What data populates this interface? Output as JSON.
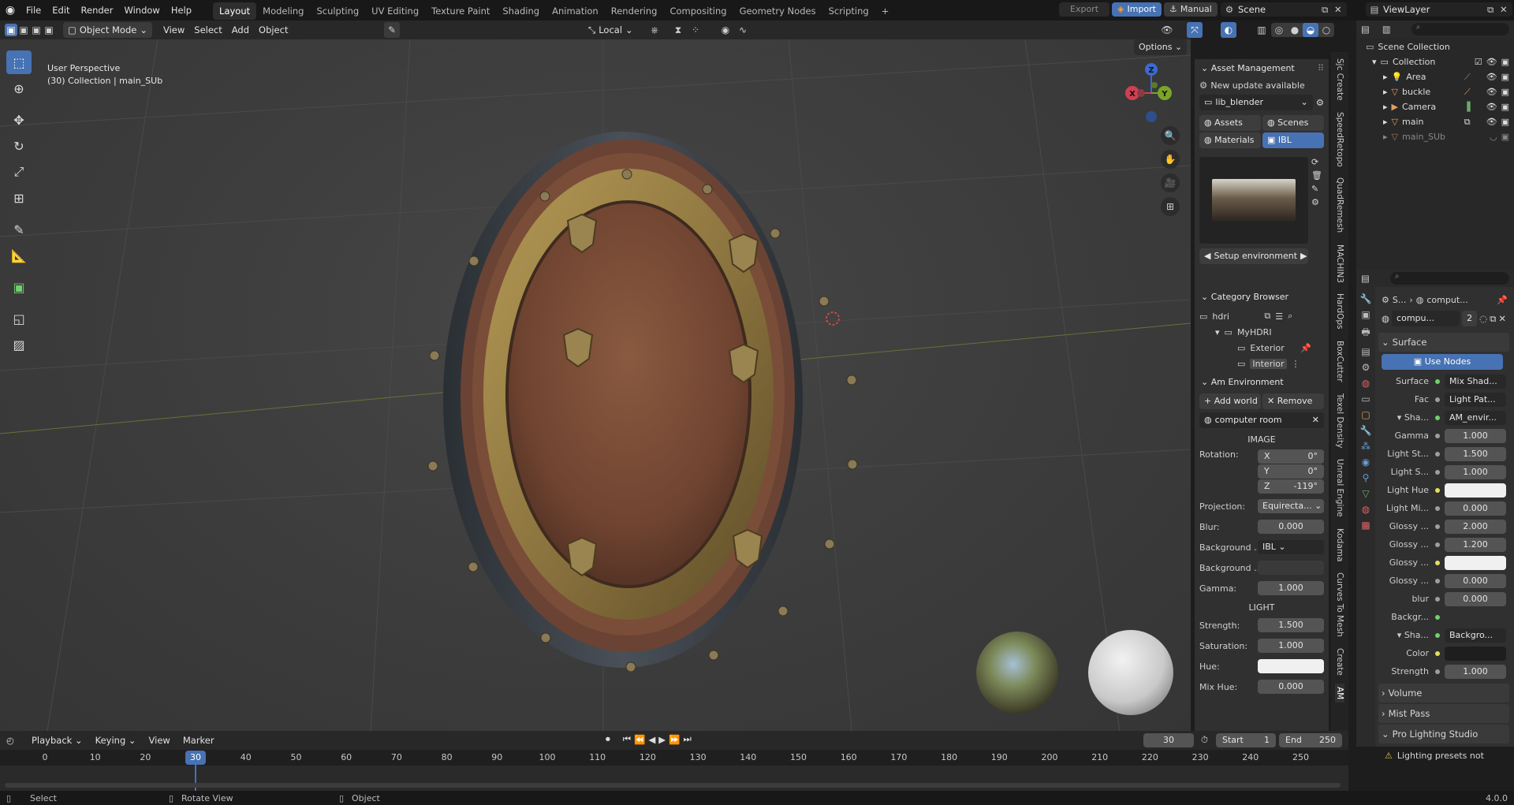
{
  "topbar": {
    "menus": [
      "File",
      "Edit",
      "Render",
      "Window",
      "Help"
    ],
    "workspaces": [
      "Layout",
      "Modeling",
      "Sculpting",
      "UV Editing",
      "Texture Paint",
      "Shading",
      "Animation",
      "Rendering",
      "Compositing",
      "Geometry Nodes",
      "Scripting"
    ],
    "active_workspace": "Layout",
    "add_tab": "+",
    "export_label": "Export",
    "import_label": "Import",
    "manual_label": "Manual",
    "scene_label": "Scene",
    "viewlayer_label": "ViewLayer"
  },
  "viewport_header": {
    "mode": "Object Mode",
    "menus": [
      "View",
      "Select",
      "Add",
      "Object"
    ],
    "transform_orientation": "Local",
    "options": "Options"
  },
  "viewport": {
    "perspective": "User Perspective",
    "collection_info": "(30) Collection | main_SUb",
    "gizmo": {
      "x": "X",
      "y": "Y",
      "z": "Z"
    },
    "tools": [
      "select-box",
      "cursor",
      "move",
      "rotate",
      "scale",
      "transform",
      "annotate",
      "measure",
      "add-cube",
      "extrude",
      "image"
    ]
  },
  "npanel": {
    "asset_management": "Asset Management",
    "update": "New update available",
    "library": "lib_blender",
    "tabs": [
      "Assets",
      "Scenes",
      "Materials",
      "IBL"
    ],
    "active_tab": "IBL",
    "setup_env": "Setup environment",
    "category_browser": "Category Browser",
    "categories": [
      "hdri",
      "MyHDRI",
      "Exterior",
      "Interior"
    ],
    "am_environment": "Am Environment",
    "add_world": "Add world",
    "remove": "Remove",
    "world_name": "computer room",
    "image_header": "IMAGE",
    "rotation_label": "Rotation:",
    "rotation": [
      {
        "axis": "X",
        "value": "0°"
      },
      {
        "axis": "Y",
        "value": "0°"
      },
      {
        "axis": "Z",
        "value": "-119°"
      }
    ],
    "projection_label": "Projection:",
    "projection": "Equirecta...",
    "blur_label": "Blur:",
    "blur": "0.000",
    "background_label": "Background ...",
    "background_value": "IBL",
    "background2_label": "Background ...",
    "gamma_label": "Gamma:",
    "gamma": "1.000",
    "light_header": "LIGHT",
    "strength_label": "Strength:",
    "strength": "1.500",
    "saturation_label": "Saturation:",
    "saturation": "1.000",
    "hue_label": "Hue:",
    "mixhue_label": "Mix Hue:",
    "mixhue": "0.000"
  },
  "vtabs": [
    "Sjc Create",
    "SpeedRetopo",
    "QuadRemesh",
    "MACHIN3",
    "HardOps",
    "BoxCutter",
    "Texel Density",
    "Unreal Engine",
    "Kodama",
    "Curves To Mesh",
    "Create",
    "AM"
  ],
  "outliner": {
    "root": "Scene Collection",
    "collection": "Collection",
    "items": [
      "Area",
      "buckle",
      "Camera",
      "main",
      "main_SUb"
    ]
  },
  "properties": {
    "breadcrumb_a": "S...",
    "breadcrumb_b": "comput...",
    "world_name": "compu...",
    "users": "2",
    "surface_header": "Surface",
    "use_nodes": "Use Nodes",
    "rows": [
      {
        "label": "Surface",
        "value": "Mix Shad..."
      },
      {
        "label": "Fac",
        "value": "Light Pat..."
      },
      {
        "label": "Sha...",
        "value": "AM_envir..."
      },
      {
        "label": "Gamma",
        "value": "1.000"
      },
      {
        "label": "Light St...",
        "value": "1.500"
      },
      {
        "label": "Light S...",
        "value": "1.000"
      },
      {
        "label": "Light Hue",
        "value": ""
      },
      {
        "label": "Light Mi...",
        "value": "0.000"
      },
      {
        "label": "Glossy ...",
        "value": "2.000"
      },
      {
        "label": "Glossy ...",
        "value": "1.200"
      },
      {
        "label": "Glossy ...",
        "value": ""
      },
      {
        "label": "Glossy ...",
        "value": "0.000"
      },
      {
        "label": "blur",
        "value": "0.000"
      },
      {
        "label": "Backgr...",
        "value": ""
      },
      {
        "label": "Sha...",
        "value": "Backgro..."
      },
      {
        "label": "Color",
        "value": ""
      },
      {
        "label": "Strength",
        "value": "1.000"
      }
    ],
    "volume": "Volume",
    "mist": "Mist Pass",
    "pro_lighting": "Pro Lighting Studio",
    "warning": "Lighting presets not"
  },
  "timeline": {
    "menus": [
      "Playback",
      "Keying",
      "View",
      "Marker"
    ],
    "current_frame": "30",
    "start_label": "Start",
    "start": "1",
    "end_label": "End",
    "end": "250",
    "ticks": [
      "0",
      "10",
      "20",
      "30",
      "40",
      "50",
      "60",
      "70",
      "80",
      "90",
      "100",
      "110",
      "120",
      "130",
      "140",
      "150",
      "160",
      "170",
      "180",
      "190",
      "200",
      "210",
      "220",
      "230",
      "240",
      "250"
    ]
  },
  "statusbar": {
    "select": "Select",
    "rotate": "Rotate View",
    "object": "Object",
    "version": "4.0.0"
  }
}
